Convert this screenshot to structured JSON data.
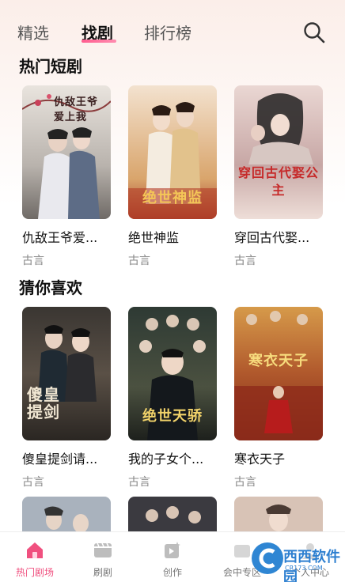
{
  "tabs": [
    {
      "label": "精选"
    },
    {
      "label": "找剧"
    },
    {
      "label": "排行榜"
    }
  ],
  "active_tab": "找剧",
  "search_icon": "search-icon",
  "sections": {
    "hot": {
      "title": "热门短剧",
      "items": [
        {
          "title": "仇敌王爷爱...",
          "tag": "古言",
          "poster_text": "仇敌王爷爱上我"
        },
        {
          "title": "绝世神监",
          "tag": "古言",
          "poster_text": "绝世神监"
        },
        {
          "title": "穿回古代娶...",
          "tag": "古言",
          "poster_text": "穿回古代娶公主"
        }
      ]
    },
    "guess": {
      "title": "猜你喜欢",
      "items": [
        {
          "title": "傻皇提剑请...",
          "tag": "古言",
          "poster_text": "傻皇提剑"
        },
        {
          "title": "我的子女个...",
          "tag": "古言",
          "poster_text": "绝世天骄"
        },
        {
          "title": "寒衣天子",
          "tag": "古言",
          "poster_text": "寒衣天子"
        }
      ]
    }
  },
  "bottom_nav": [
    {
      "label": "热门剧场",
      "icon": "home-icon"
    },
    {
      "label": "刷剧",
      "icon": "video-icon"
    },
    {
      "label": "创作",
      "icon": "create-icon"
    },
    {
      "label": "会中专区",
      "icon": "zone-icon"
    },
    {
      "label": "个人中心",
      "icon": "user-icon"
    }
  ],
  "watermark": {
    "text": "西西软件园",
    "sub": "CR173.COM"
  },
  "colors": {
    "accent": "#f0507f",
    "accent_gradient_end": "#ff8db0"
  }
}
